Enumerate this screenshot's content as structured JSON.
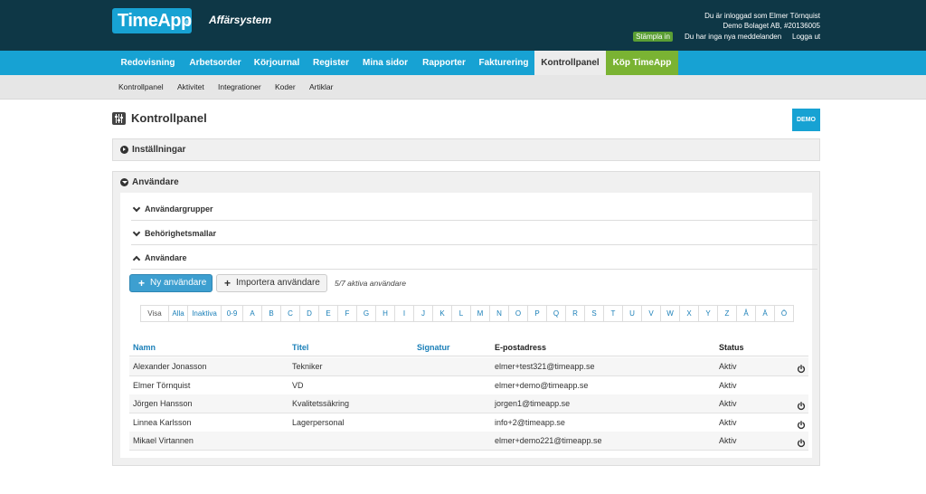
{
  "header": {
    "logo_text": "TimeApp",
    "logo_mark": "®",
    "subtitle": "Affärsystem",
    "logged_in": "Du är inloggad som Elmer Törnquist",
    "company": "Demo Bolaget AB, #20136005",
    "stamp_label": "Stämpla in",
    "messages": "Du har inga nya meddelanden",
    "logout": "Logga ut"
  },
  "main_nav": [
    {
      "label": "Redovisning"
    },
    {
      "label": "Arbetsorder"
    },
    {
      "label": "Körjournal"
    },
    {
      "label": "Register"
    },
    {
      "label": "Mina sidor"
    },
    {
      "label": "Rapporter"
    },
    {
      "label": "Fakturering"
    },
    {
      "label": "Kontrollpanel"
    },
    {
      "label": "Köp TimeApp"
    }
  ],
  "sub_nav": [
    {
      "label": "Kontrollpanel"
    },
    {
      "label": "Aktivitet"
    },
    {
      "label": "Integrationer"
    },
    {
      "label": "Koder"
    },
    {
      "label": "Artiklar"
    }
  ],
  "page": {
    "title": "Kontrollpanel",
    "demo_badge": "DEMO"
  },
  "panels": {
    "settings": "Inställningar",
    "users": "Användare"
  },
  "sections": {
    "groups": "Användargrupper",
    "templates": "Behörighetsmallar",
    "users": "Användare"
  },
  "actions": {
    "new_user": "Ny användare",
    "import_users": "Importera användare",
    "active_count": "5/7 aktiva användare"
  },
  "filter": {
    "labels": [
      "Visa",
      "Alla",
      "Inaktiva",
      "0-9",
      "A",
      "B",
      "C",
      "D",
      "E",
      "F",
      "G",
      "H",
      "I",
      "J",
      "K",
      "L",
      "M",
      "N",
      "O",
      "P",
      "Q",
      "R",
      "S",
      "T",
      "U",
      "V",
      "W",
      "X",
      "Y",
      "Z",
      "Å",
      "Ä",
      "Ö"
    ]
  },
  "table": {
    "columns": {
      "name": "Namn",
      "title": "Titel",
      "signature": "Signatur",
      "email": "E-postadress",
      "status": "Status"
    },
    "rows": [
      {
        "name": "Alexander Jonasson",
        "title": "Tekniker",
        "signature": "",
        "email": "elmer+test321@timeapp.se",
        "status": "Aktiv",
        "power": true
      },
      {
        "name": "Elmer Törnquist",
        "title": "VD",
        "signature": "",
        "email": "elmer+demo@timeapp.se",
        "status": "Aktiv",
        "power": false
      },
      {
        "name": "Jörgen Hansson",
        "title": "Kvalitetssäkring",
        "signature": "",
        "email": "jorgen1@timeapp.se",
        "status": "Aktiv",
        "power": true
      },
      {
        "name": "Linnea Karlsson",
        "title": "Lagerpersonal",
        "signature": "",
        "email": "info+2@timeapp.se",
        "status": "Aktiv",
        "power": true
      },
      {
        "name": "Mikael Virtannen",
        "title": "",
        "signature": "",
        "email": "elmer+demo221@timeapp.se",
        "status": "Aktiv",
        "power": true
      }
    ]
  },
  "icons": {
    "title_icon": "control-panel-icon",
    "power_icon": "power-icon",
    "plus_icon": "plus-icon"
  },
  "colors": {
    "header_bg": "#0e3746",
    "brand_blue": "#17a2d3",
    "buy_green": "#7ab333",
    "stamp_green": "#5a9e34",
    "link_blue": "#1a7fb8"
  }
}
